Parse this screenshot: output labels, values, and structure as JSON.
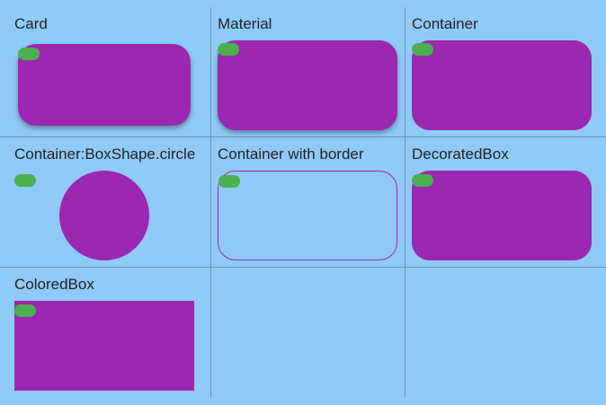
{
  "colors": {
    "background": "#90CAF9",
    "shape_fill": "#9C27B0",
    "pill": "#4CAF50",
    "divider": "#6f8fa8"
  },
  "cells": [
    {
      "label": "Card"
    },
    {
      "label": "Material"
    },
    {
      "label": "Container"
    },
    {
      "label": "Container:BoxShape.circle"
    },
    {
      "label": "Container with border"
    },
    {
      "label": "DecoratedBox"
    },
    {
      "label": "ColoredBox"
    }
  ]
}
